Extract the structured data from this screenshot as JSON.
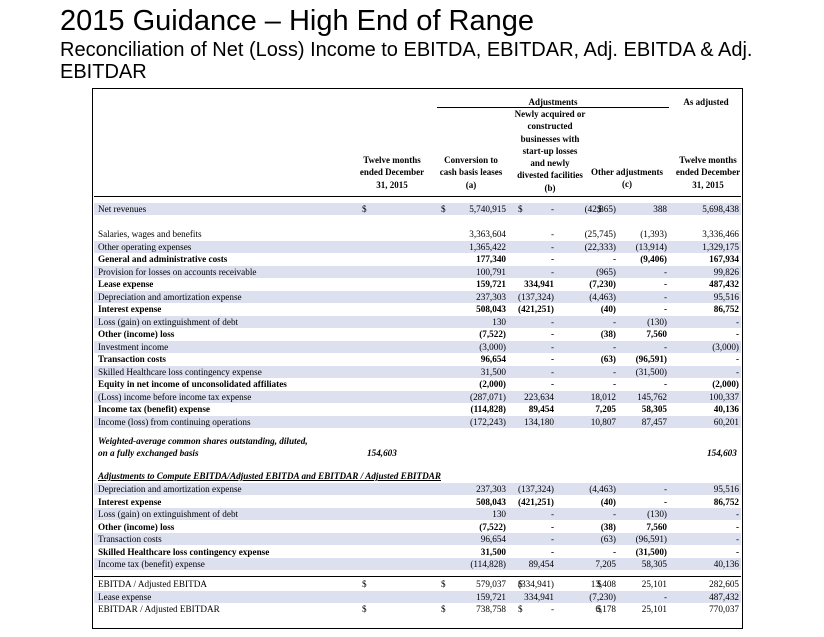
{
  "title": "2015 Guidance – High End of Range",
  "subtitle": "Reconciliation of Net (Loss) Income to EBITDA, EBITDAR, Adj. EBITDA & Adj. EBITDAR",
  "headers": {
    "adjustments": "Adjustments",
    "as_adjusted": "As adjusted",
    "col1": [
      "Twelve months",
      "ended December",
      "31, 2015"
    ],
    "col2": [
      "Conversion to",
      "cash basis leases",
      "(a)"
    ],
    "col3": [
      "Newly acquired or",
      "constructed",
      "businesses with",
      "start-up losses",
      "and newly",
      "divested facilities",
      "(b)"
    ],
    "col4": [
      "Other adjustments",
      "(c)"
    ],
    "col5": [
      "Twelve months",
      "ended December",
      "31, 2015"
    ]
  },
  "rows": [
    {
      "label": "Net revenues",
      "v": [
        "5,740,915",
        "-",
        "(42,865)",
        "388",
        "5,698,438"
      ],
      "dollars": [
        "$",
        "$",
        "$",
        "$"
      ]
    },
    {
      "label": "Salaries, wages and benefits",
      "v": [
        "3,363,604",
        "-",
        "(25,745)",
        "(1,393)",
        "3,336,466"
      ]
    },
    {
      "label": "Other operating expenses",
      "v": [
        "1,365,422",
        "-",
        "(22,333)",
        "(13,914)",
        "1,329,175"
      ]
    },
    {
      "label": "General and administrative costs",
      "v": [
        "177,340",
        "-",
        "-",
        "(9,406)",
        "167,934"
      ]
    },
    {
      "label": "Provision for losses on accounts receivable",
      "v": [
        "100,791",
        "-",
        "(965)",
        "-",
        "99,826"
      ]
    },
    {
      "label": "Lease expense",
      "v": [
        "159,721",
        "334,941",
        "(7,230)",
        "-",
        "487,432"
      ]
    },
    {
      "label": "Depreciation and amortization expense",
      "v": [
        "237,303",
        "(137,324)",
        "(4,463)",
        "-",
        "95,516"
      ]
    },
    {
      "label": "Interest expense",
      "v": [
        "508,043",
        "(421,251)",
        "(40)",
        "-",
        "86,752"
      ]
    },
    {
      "label": "Loss (gain) on extinguishment of debt",
      "v": [
        "130",
        "-",
        "-",
        "(130)",
        "-"
      ]
    },
    {
      "label": "Other (income) loss",
      "v": [
        "(7,522)",
        "-",
        "(38)",
        "7,560",
        "-"
      ]
    },
    {
      "label": "Investment income",
      "v": [
        "(3,000)",
        "-",
        "-",
        "-",
        "(3,000)"
      ]
    },
    {
      "label": "Transaction costs",
      "v": [
        "96,654",
        "-",
        "(63)",
        "(96,591)",
        "-"
      ]
    },
    {
      "label": "Skilled Healthcare loss contingency expense",
      "v": [
        "31,500",
        "-",
        "-",
        "(31,500)",
        "-"
      ]
    },
    {
      "label": "Equity in net income of unconsolidated affiliates",
      "v": [
        "(2,000)",
        "-",
        "-",
        "-",
        "(2,000)"
      ]
    },
    {
      "label": "(Loss) income before income tax expense",
      "v": [
        "(287,071)",
        "223,634",
        "18,012",
        "145,762",
        "100,337"
      ]
    },
    {
      "label": "Income tax (benefit) expense",
      "v": [
        "(114,828)",
        "89,454",
        "7,205",
        "58,305",
        "40,136"
      ]
    },
    {
      "label": "Income (loss) from continuing operations",
      "v": [
        "(172,243)",
        "134,180",
        "10,807",
        "87,457",
        "60,201"
      ]
    }
  ],
  "weighted": {
    "line1": "Weighted-average common shares outstanding, diluted,",
    "line2": "on a fully exchanged basis",
    "v1": "154,603",
    "v5": "154,603"
  },
  "section_title": "Adjustments to Compute EBITDA/Adjusted EBITDA and EBITDAR / Adjusted EBITDAR",
  "adj_rows": [
    {
      "label": "Depreciation and amortization expense",
      "v": [
        "237,303",
        "(137,324)",
        "(4,463)",
        "-",
        "95,516"
      ]
    },
    {
      "label": "Interest expense",
      "v": [
        "508,043",
        "(421,251)",
        "(40)",
        "-",
        "86,752"
      ]
    },
    {
      "label": "Loss (gain) on extinguishment of debt",
      "v": [
        "130",
        "-",
        "-",
        "(130)",
        "-"
      ]
    },
    {
      "label": "Other (income) loss",
      "v": [
        "(7,522)",
        "-",
        "(38)",
        "7,560",
        "-"
      ]
    },
    {
      "label": "Transaction costs",
      "v": [
        "96,654",
        "-",
        "(63)",
        "(96,591)",
        "-"
      ]
    },
    {
      "label": "Skilled Healthcare loss contingency expense",
      "v": [
        "31,500",
        "-",
        "-",
        "(31,500)",
        "-"
      ]
    },
    {
      "label": "Income tax (benefit) expense",
      "v": [
        "(114,828)",
        "89,454",
        "7,205",
        "58,305",
        "40,136"
      ]
    }
  ],
  "totals": [
    {
      "label": "EBITDA / Adjusted EBITDA",
      "v": [
        "579,037",
        "(334,941)",
        "13,408",
        "25,101",
        "282,605"
      ],
      "dollars": [
        "$",
        "$",
        "$",
        "$"
      ]
    },
    {
      "label": "Lease expense",
      "v": [
        "159,721",
        "334,941",
        "(7,230)",
        "-",
        "487,432"
      ]
    },
    {
      "label": "EBITDAR / Adjusted EBITDAR",
      "v": [
        "738,758",
        "-",
        "6,178",
        "25,101",
        "770,037"
      ],
      "dollars": [
        "$",
        "$",
        "$",
        "$"
      ]
    }
  ]
}
